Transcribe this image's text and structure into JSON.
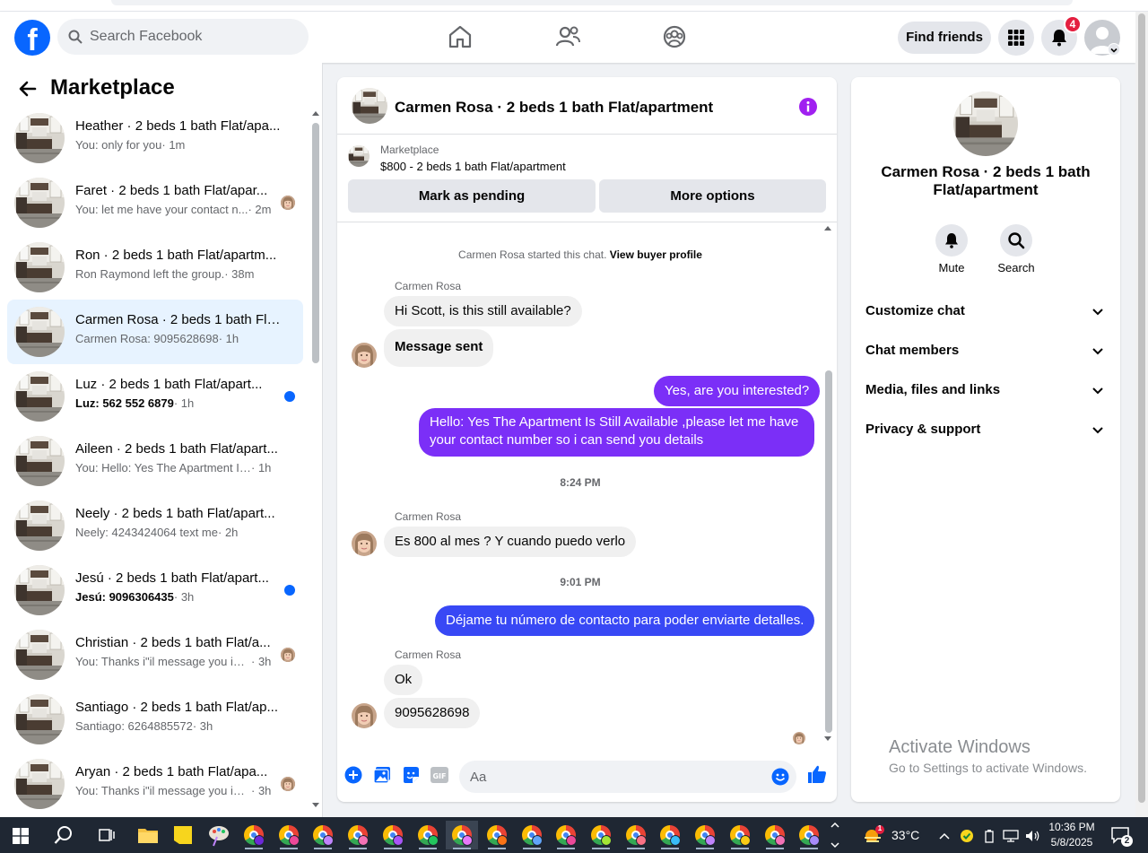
{
  "search": {
    "placeholder": "Search Facebook"
  },
  "header": {
    "find_friends": "Find friends",
    "notification_count": "4"
  },
  "sidebar": {
    "title": "Marketplace",
    "conversations": [
      {
        "title": "Heather · 2 beds 1 bath Flat/apa...",
        "snippet": "You: only for you",
        "time": "· 1m",
        "unread": false,
        "indicator": "none"
      },
      {
        "title": "Faret · 2 beds 1 bath Flat/apar...",
        "snippet": "You: let me have your contact n...",
        "time": "· 2m",
        "unread": false,
        "indicator": "avatar"
      },
      {
        "title": "Ron · 2 beds 1 bath Flat/apartm...",
        "snippet": "Ron Raymond left the group.",
        "time": "· 38m",
        "unread": false,
        "indicator": "none"
      },
      {
        "title": "Carmen Rosa · 2 beds 1 bath Flat...",
        "snippet": "Carmen Rosa: 9095628698",
        "time": "· 1h",
        "unread": false,
        "indicator": "none",
        "active": true
      },
      {
        "title": "Luz · 2 beds 1 bath Flat/apart...",
        "snippet": "Luz: 562 552 6879",
        "time": "· 1h",
        "unread": true,
        "indicator": "dot"
      },
      {
        "title": "Aileen · 2 beds 1 bath Flat/apart...",
        "snippet": "You: Hello: Yes The Apartment Is Sti...",
        "time": "· 1h",
        "unread": false,
        "indicator": "none"
      },
      {
        "title": "Neely · 2 beds 1 bath Flat/apart...",
        "snippet": "Neely: 4243424064 text me",
        "time": "· 2h",
        "unread": false,
        "indicator": "none"
      },
      {
        "title": "Jesú · 2 beds 1 bath Flat/apart...",
        "snippet": "Jesú: 9096306435",
        "time": "· 3h",
        "unread": true,
        "indicator": "dot"
      },
      {
        "title": "Christian · 2 beds 1 bath Flat/a...",
        "snippet": "You: Thanks i\"il message you in ...",
        "time": "· 3h",
        "unread": false,
        "indicator": "avatar"
      },
      {
        "title": "Santiago · 2 beds 1 bath Flat/ap...",
        "snippet": "Santiago: 6264885572",
        "time": "· 3h",
        "unread": false,
        "indicator": "none"
      },
      {
        "title": "Aryan · 2 beds 1 bath Flat/apa...",
        "snippet": "You: Thanks i\"il message you in ...",
        "time": "· 3h",
        "unread": false,
        "indicator": "avatar"
      }
    ]
  },
  "chat": {
    "title": "Carmen Rosa · 2 beds 1 bath Flat/apartment",
    "marketplace_label": "Marketplace",
    "listing": "$800 - 2 beds 1 bath Flat/apartment",
    "mark_pending": "Mark as pending",
    "more_options": "More options",
    "started": "Carmen Rosa started this chat.",
    "view_buyer": "View buyer profile",
    "sender_name": "Carmen Rosa",
    "messages": {
      "m1": "Hi Scott, is this still available?",
      "m2": "Message sent",
      "m3": "Yes, are you interested?",
      "m4": "Hello: Yes The Apartment Is Still Available ,please let me have your contact number so i can send you details",
      "t1": "8:24 PM",
      "m5": "Es 800 al mes ? Y cuando puedo verlo",
      "t2": "9:01 PM",
      "m6": "Déjame tu número de contacto para poder enviarte detalles.",
      "m7": "Ok",
      "m8": "9095628698"
    },
    "composer_placeholder": "Aa"
  },
  "info": {
    "title": "Carmen Rosa · 2 beds 1 bath Flat/apartment",
    "mute": "Mute",
    "search": "Search",
    "sections": [
      "Customize chat",
      "Chat members",
      "Media, files and links",
      "Privacy & support"
    ]
  },
  "watermark": {
    "line1": "Activate Windows",
    "line2": "Go to Settings to activate Windows."
  },
  "taskbar": {
    "temperature": "33°C",
    "time": "10:36 PM",
    "date": "5/8/2025",
    "notifications": "2",
    "weather_badge": "1"
  },
  "colors": {
    "facebook_blue": "#0866ff",
    "outgoing_purple": "#7b2ff7",
    "outgoing_blue": "#3848f5",
    "active_row": "#e7f3ff",
    "badge_red": "#e41e3f"
  }
}
